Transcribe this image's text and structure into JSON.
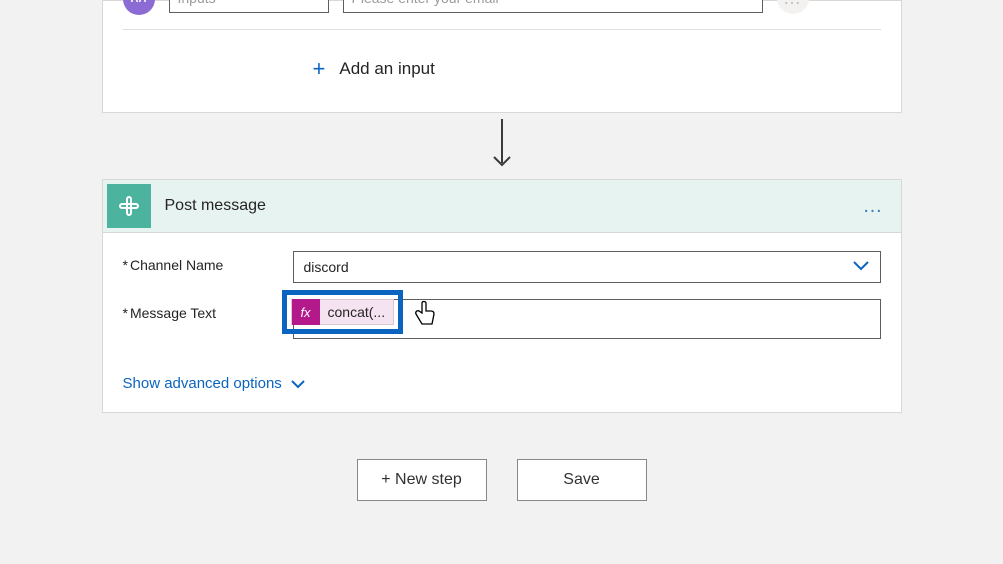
{
  "top_card": {
    "avatar_initials": "AA",
    "input_name": "Inputs",
    "input_placeholder": "Please enter your email",
    "dots_label": "…",
    "add_input_label": "Add an input"
  },
  "action_card": {
    "title": "Post message",
    "dots": "…",
    "fields": {
      "channel_label": "Channel Name",
      "channel_value": "discord",
      "message_label": "Message Text",
      "fx_badge": "fx",
      "expression_text": "concat(..."
    },
    "advanced_label": "Show advanced options"
  },
  "buttons": {
    "new_step": "+ New step",
    "save": "Save"
  }
}
